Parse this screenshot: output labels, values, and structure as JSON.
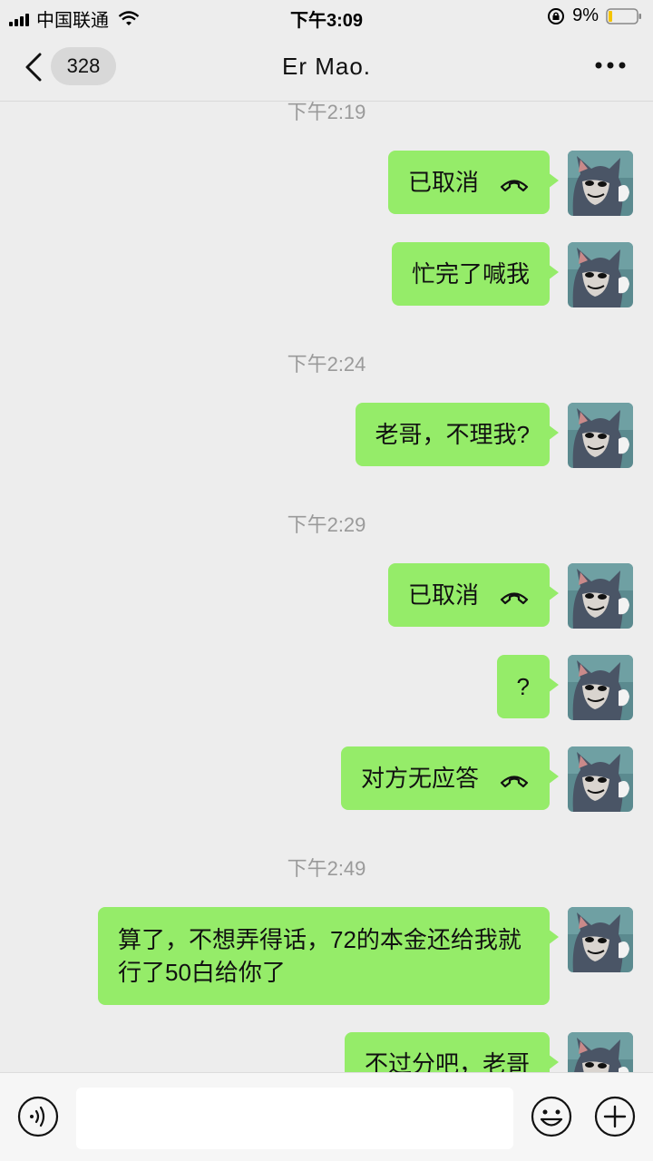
{
  "status_bar": {
    "carrier": "中国联通",
    "time": "下午3:09",
    "battery": "9%"
  },
  "nav": {
    "unread_count": "328",
    "title": "Er  Mao."
  },
  "messages": {
    "ts1": "下午2:19",
    "m1": "已取消",
    "m2": "忙完了喊我",
    "ts2": "下午2:24",
    "m3": "老哥，不理我?",
    "ts3": "下午2:29",
    "m4": "已取消",
    "m5": "?",
    "m6": "对方无应答",
    "ts4": "下午2:49",
    "m7": "算了，不想弄得话，72的本金还给我就行了50白给你了",
    "m8": "不过分吧，老哥"
  },
  "input": {
    "placeholder": ""
  },
  "colors": {
    "bubble": "#95ec69",
    "background": "#ededed"
  },
  "icons": [
    "back-icon",
    "more-icon",
    "phone-hangup-icon",
    "voice-icon",
    "emoji-icon",
    "plus-icon"
  ]
}
